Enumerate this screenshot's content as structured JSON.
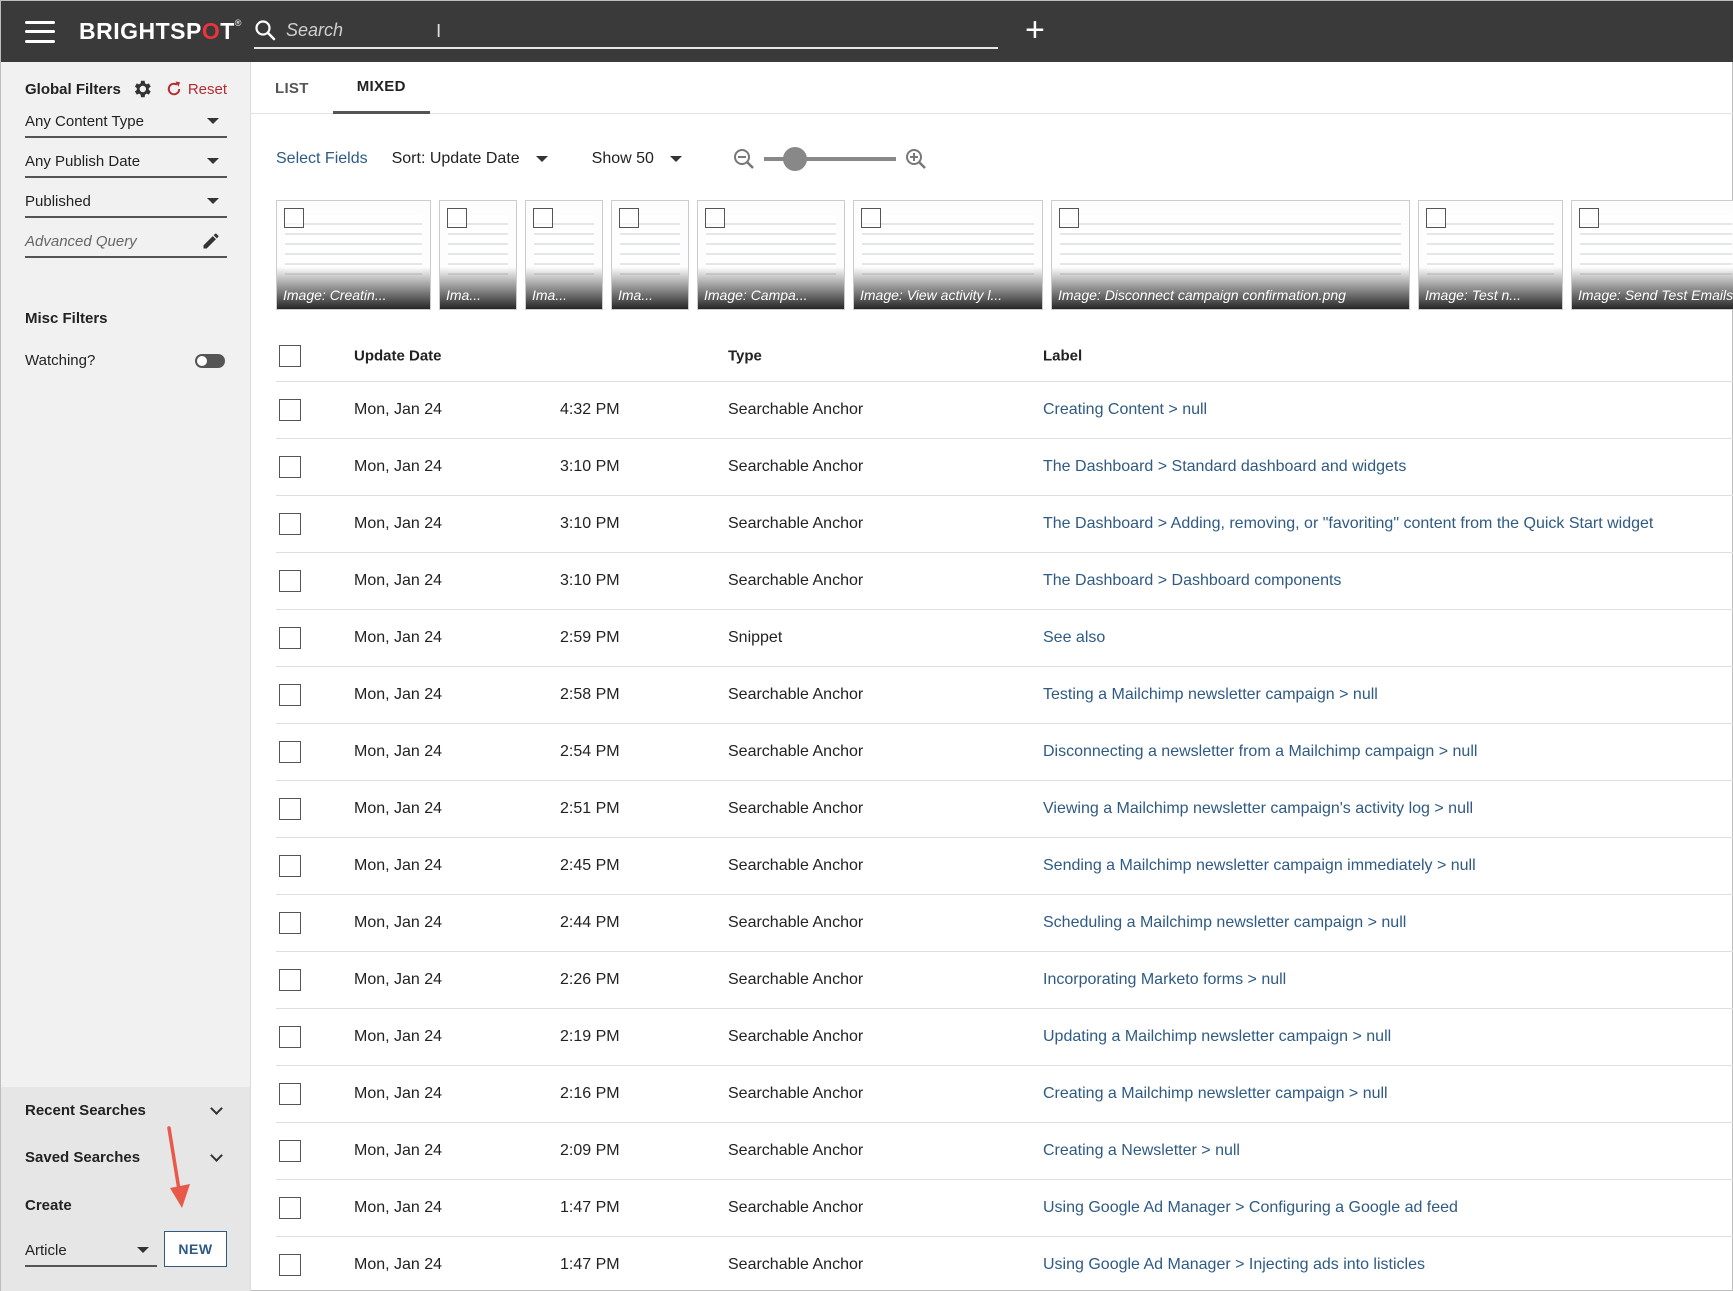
{
  "header": {
    "logo": {
      "pre": "BRIGHTSP",
      "o": "O",
      "post": "T",
      "mark": "®"
    },
    "search_placeholder": "Search",
    "add_label": "+"
  },
  "sidebar": {
    "global_filters_title": "Global Filters",
    "reset_label": "Reset",
    "filters": [
      "Any Content Type",
      "Any Publish Date",
      "Published"
    ],
    "advanced_query_placeholder": "Advanced Query",
    "misc_filters_title": "Misc Filters",
    "watching_label": "Watching?",
    "recent_searches_label": "Recent Searches",
    "saved_searches_label": "Saved Searches",
    "create_title": "Create",
    "create_type": "Article",
    "new_button": "NEW"
  },
  "tabs": [
    {
      "label": "LIST",
      "active": false
    },
    {
      "label": "MIXED",
      "active": true
    }
  ],
  "toolbar": {
    "select_fields": "Select Fields",
    "sort": "Sort: Update Date",
    "show": "Show 50",
    "zoom_level": 0.18
  },
  "thumbnails": [
    "Image: Creatin...",
    "Ima...",
    "Ima...",
    "Ima...",
    "Image: Campa...",
    "Image: View activity l...",
    "Image: Disconnect campaign confirmation.png",
    "Image: Test n...",
    "Image: Send Test Emails"
  ],
  "table": {
    "headers": {
      "date": "Update Date",
      "type": "Type",
      "label": "Label"
    },
    "rows": [
      {
        "date": "Mon, Jan 24",
        "time": "4:32 PM",
        "type": "Searchable Anchor",
        "label": "Creating Content > null"
      },
      {
        "date": "Mon, Jan 24",
        "time": "3:10 PM",
        "type": "Searchable Anchor",
        "label": "The Dashboard > Standard dashboard and widgets"
      },
      {
        "date": "Mon, Jan 24",
        "time": "3:10 PM",
        "type": "Searchable Anchor",
        "label": "The Dashboard > Adding, removing, or \"favoriting\" content from the Quick Start widget"
      },
      {
        "date": "Mon, Jan 24",
        "time": "3:10 PM",
        "type": "Searchable Anchor",
        "label": "The Dashboard > Dashboard components"
      },
      {
        "date": "Mon, Jan 24",
        "time": "2:59 PM",
        "type": "Snippet",
        "label": "See also"
      },
      {
        "date": "Mon, Jan 24",
        "time": "2:58 PM",
        "type": "Searchable Anchor",
        "label": "Testing a Mailchimp newsletter campaign > null"
      },
      {
        "date": "Mon, Jan 24",
        "time": "2:54 PM",
        "type": "Searchable Anchor",
        "label": "Disconnecting a newsletter from a Mailchimp campaign > null"
      },
      {
        "date": "Mon, Jan 24",
        "time": "2:51 PM",
        "type": "Searchable Anchor",
        "label": "Viewing a Mailchimp newsletter campaign's activity log > null"
      },
      {
        "date": "Mon, Jan 24",
        "time": "2:45 PM",
        "type": "Searchable Anchor",
        "label": "Sending a Mailchimp newsletter campaign immediately > null"
      },
      {
        "date": "Mon, Jan 24",
        "time": "2:44 PM",
        "type": "Searchable Anchor",
        "label": "Scheduling a Mailchimp newsletter campaign > null"
      },
      {
        "date": "Mon, Jan 24",
        "time": "2:26 PM",
        "type": "Searchable Anchor",
        "label": "Incorporating Marketo forms > null"
      },
      {
        "date": "Mon, Jan 24",
        "time": "2:19 PM",
        "type": "Searchable Anchor",
        "label": "Updating a Mailchimp newsletter campaign > null"
      },
      {
        "date": "Mon, Jan 24",
        "time": "2:16 PM",
        "type": "Searchable Anchor",
        "label": "Creating a Mailchimp newsletter campaign > null"
      },
      {
        "date": "Mon, Jan 24",
        "time": "2:09 PM",
        "type": "Searchable Anchor",
        "label": "Creating a Newsletter > null"
      },
      {
        "date": "Mon, Jan 24",
        "time": "1:47 PM",
        "type": "Searchable Anchor",
        "label": "Using Google Ad Manager > Configuring a Google ad feed"
      },
      {
        "date": "Mon, Jan 24",
        "time": "1:47 PM",
        "type": "Searchable Anchor",
        "label": "Using Google Ad Manager > Injecting ads into listicles"
      }
    ]
  },
  "colors": {
    "topbar": "#3a3a3a",
    "link": "#2e5a84",
    "reset": "#b22d30",
    "logo_accent": "#e8343f",
    "annotation_arrow": "#e8594a"
  },
  "icons": [
    "hamburger-icon",
    "search-icon",
    "plus-icon",
    "gear-icon",
    "reset-icon",
    "pencil-icon",
    "chevron-down-icon",
    "zoom-out-icon",
    "zoom-in-icon",
    "annotation-arrow-icon"
  ]
}
